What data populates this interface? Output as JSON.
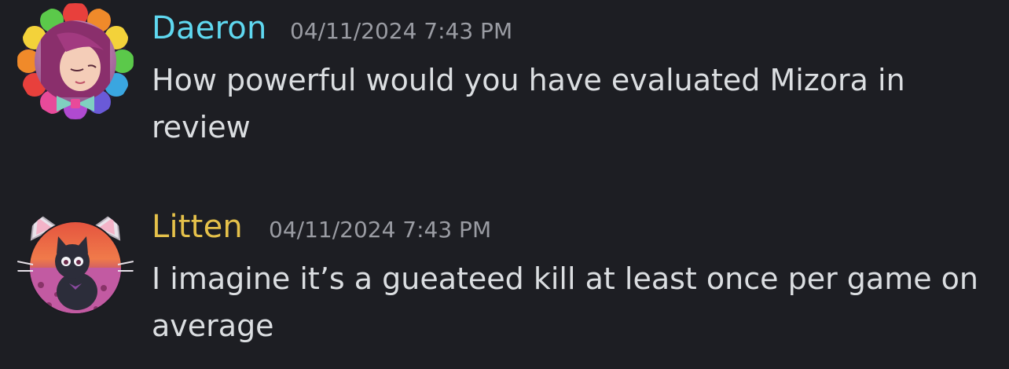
{
  "messages": [
    {
      "author": "Daeron",
      "author_color": "#5fd8f0",
      "timestamp": "04/11/2024 7:43 PM",
      "content": "How powerful would you have evaluated Mizora in review",
      "avatar": "avatar-rainbow-flower-girl"
    },
    {
      "author": "Litten",
      "author_color": "#e5c14a",
      "timestamp": "04/11/2024 7:43 PM",
      "content": "I imagine it’s a gueateed kill at least once per game on average",
      "avatar": "avatar-black-cat-sunset"
    }
  ],
  "colors": {
    "background": "#1d1e23",
    "text": "#dbdee1",
    "timestamp": "#9a9ca3"
  }
}
